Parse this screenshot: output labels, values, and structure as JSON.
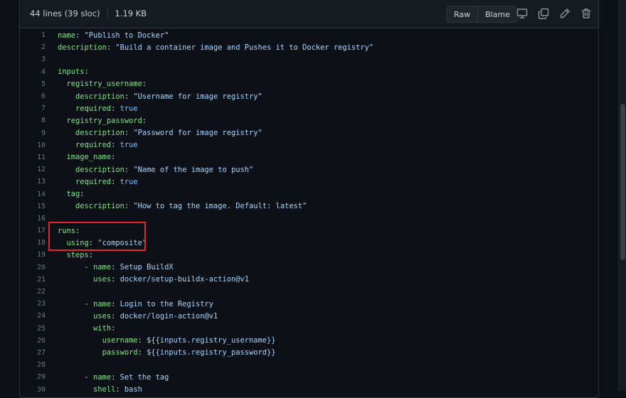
{
  "file_info": {
    "lines": "44 lines (39 sloc)",
    "size": "1.19 KB"
  },
  "toolbar": {
    "raw_label": "Raw",
    "blame_label": "Blame",
    "icons": [
      "desktop-icon",
      "copy-icon",
      "pencil-icon",
      "trash-icon"
    ]
  },
  "colors": {
    "key": "#7ee787",
    "string": "#a5d6ff",
    "boolean": "#79c0ff",
    "highlight": "#e5262b"
  },
  "code_lines": [
    {
      "n": "1",
      "t": [
        [
          "k",
          "name"
        ],
        [
          "p",
          ": "
        ],
        [
          "s",
          "\"Publish to Docker\""
        ]
      ]
    },
    {
      "n": "2",
      "t": [
        [
          "k",
          "description"
        ],
        [
          "p",
          ": "
        ],
        [
          "s",
          "\"Build a container image and Pushes it to Docker registry\""
        ]
      ]
    },
    {
      "n": "3",
      "t": []
    },
    {
      "n": "4",
      "t": [
        [
          "k",
          "inputs"
        ],
        [
          "p",
          ":"
        ]
      ]
    },
    {
      "n": "5",
      "t": [
        [
          "p",
          "  "
        ],
        [
          "k",
          "registry_username"
        ],
        [
          "p",
          ":"
        ]
      ]
    },
    {
      "n": "6",
      "t": [
        [
          "p",
          "    "
        ],
        [
          "k",
          "description"
        ],
        [
          "p",
          ": "
        ],
        [
          "s",
          "\"Username for image registry\""
        ]
      ]
    },
    {
      "n": "7",
      "t": [
        [
          "p",
          "    "
        ],
        [
          "k",
          "required"
        ],
        [
          "p",
          ": "
        ],
        [
          "b",
          "true"
        ]
      ]
    },
    {
      "n": "8",
      "t": [
        [
          "p",
          "  "
        ],
        [
          "k",
          "registry_password"
        ],
        [
          "p",
          ":"
        ]
      ]
    },
    {
      "n": "9",
      "t": [
        [
          "p",
          "    "
        ],
        [
          "k",
          "description"
        ],
        [
          "p",
          ": "
        ],
        [
          "s",
          "\"Password for image registry\""
        ]
      ]
    },
    {
      "n": "10",
      "t": [
        [
          "p",
          "    "
        ],
        [
          "k",
          "required"
        ],
        [
          "p",
          ": "
        ],
        [
          "b",
          "true"
        ]
      ]
    },
    {
      "n": "11",
      "t": [
        [
          "p",
          "  "
        ],
        [
          "k",
          "image_name"
        ],
        [
          "p",
          ":"
        ]
      ]
    },
    {
      "n": "12",
      "t": [
        [
          "p",
          "    "
        ],
        [
          "k",
          "description"
        ],
        [
          "p",
          ": "
        ],
        [
          "s",
          "\"Name of the image to push\""
        ]
      ]
    },
    {
      "n": "13",
      "t": [
        [
          "p",
          "    "
        ],
        [
          "k",
          "required"
        ],
        [
          "p",
          ": "
        ],
        [
          "b",
          "true"
        ]
      ]
    },
    {
      "n": "14",
      "t": [
        [
          "p",
          "  "
        ],
        [
          "k",
          "tag"
        ],
        [
          "p",
          ":"
        ]
      ]
    },
    {
      "n": "15",
      "t": [
        [
          "p",
          "    "
        ],
        [
          "k",
          "description"
        ],
        [
          "p",
          ": "
        ],
        [
          "s",
          "\"How to tag the image. Default: latest\""
        ]
      ]
    },
    {
      "n": "16",
      "t": []
    },
    {
      "n": "17",
      "t": [
        [
          "k",
          "runs"
        ],
        [
          "p",
          ":"
        ]
      ]
    },
    {
      "n": "18",
      "t": [
        [
          "p",
          "  "
        ],
        [
          "k",
          "using"
        ],
        [
          "p",
          ": "
        ],
        [
          "s",
          "\"composite\""
        ]
      ]
    },
    {
      "n": "19",
      "t": [
        [
          "p",
          "  "
        ],
        [
          "k",
          "steps"
        ],
        [
          "p",
          ":"
        ]
      ]
    },
    {
      "n": "20",
      "t": [
        [
          "p",
          "      - "
        ],
        [
          "k",
          "name"
        ],
        [
          "p",
          ": "
        ],
        [
          "s",
          "Setup BuildX"
        ]
      ]
    },
    {
      "n": "21",
      "t": [
        [
          "p",
          "        "
        ],
        [
          "k",
          "uses"
        ],
        [
          "p",
          ": "
        ],
        [
          "s",
          "docker/setup-buildx-action@v1"
        ]
      ]
    },
    {
      "n": "22",
      "t": []
    },
    {
      "n": "23",
      "t": [
        [
          "p",
          "      - "
        ],
        [
          "k",
          "name"
        ],
        [
          "p",
          ": "
        ],
        [
          "s",
          "Login to the Registry"
        ]
      ]
    },
    {
      "n": "24",
      "t": [
        [
          "p",
          "        "
        ],
        [
          "k",
          "uses"
        ],
        [
          "p",
          ": "
        ],
        [
          "s",
          "docker/login-action@v1"
        ]
      ]
    },
    {
      "n": "25",
      "t": [
        [
          "p",
          "        "
        ],
        [
          "k",
          "with"
        ],
        [
          "p",
          ":"
        ]
      ]
    },
    {
      "n": "26",
      "t": [
        [
          "p",
          "          "
        ],
        [
          "k",
          "username"
        ],
        [
          "p",
          ": "
        ],
        [
          "s",
          "${{inputs.registry_username}}"
        ]
      ]
    },
    {
      "n": "27",
      "t": [
        [
          "p",
          "          "
        ],
        [
          "k",
          "password"
        ],
        [
          "p",
          ": "
        ],
        [
          "s",
          "${{inputs.registry_password}}"
        ]
      ]
    },
    {
      "n": "28",
      "t": []
    },
    {
      "n": "29",
      "t": [
        [
          "p",
          "      - "
        ],
        [
          "k",
          "name"
        ],
        [
          "p",
          ": "
        ],
        [
          "s",
          "Set the tag"
        ]
      ]
    },
    {
      "n": "30",
      "t": [
        [
          "p",
          "        "
        ],
        [
          "k",
          "shell"
        ],
        [
          "p",
          ": "
        ],
        [
          "s",
          "bash"
        ]
      ]
    }
  ]
}
